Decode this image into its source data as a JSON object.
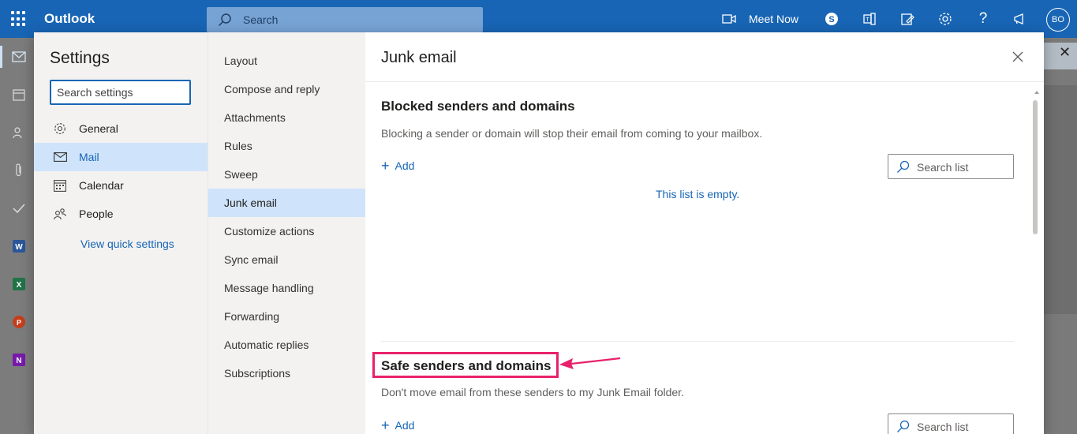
{
  "topbar": {
    "app_name": "Outlook",
    "search_placeholder": "Search",
    "meet_now": "Meet Now",
    "avatar_initials": "BO"
  },
  "settings": {
    "title": "Settings",
    "search_placeholder": "Search settings",
    "categories": [
      {
        "label": "General",
        "icon": "gear-icon"
      },
      {
        "label": "Mail",
        "icon": "mail-icon",
        "selected": true
      },
      {
        "label": "Calendar",
        "icon": "calendar-icon"
      },
      {
        "label": "People",
        "icon": "people-icon"
      }
    ],
    "quick_settings_link": "View quick settings"
  },
  "mail_subsections": [
    "Layout",
    "Compose and reply",
    "Attachments",
    "Rules",
    "Sweep",
    "Junk email",
    "Customize actions",
    "Sync email",
    "Message handling",
    "Forwarding",
    "Automatic replies",
    "Subscriptions"
  ],
  "selected_subsection": "Junk email",
  "pane": {
    "title": "Junk email",
    "blocked": {
      "heading": "Blocked senders and domains",
      "description": "Blocking a sender or domain will stop their email from coming to your mailbox.",
      "add_label": "Add",
      "search_placeholder": "Search list",
      "empty_text": "This list is empty."
    },
    "safe": {
      "heading": "Safe senders and domains",
      "description": "Don't move email from these senders to my Junk Email folder.",
      "add_label": "Add",
      "search_placeholder": "Search list"
    }
  },
  "colors": {
    "brand": "#1865b5",
    "selection": "#cfe4fa",
    "annotation": "#e8216b"
  }
}
